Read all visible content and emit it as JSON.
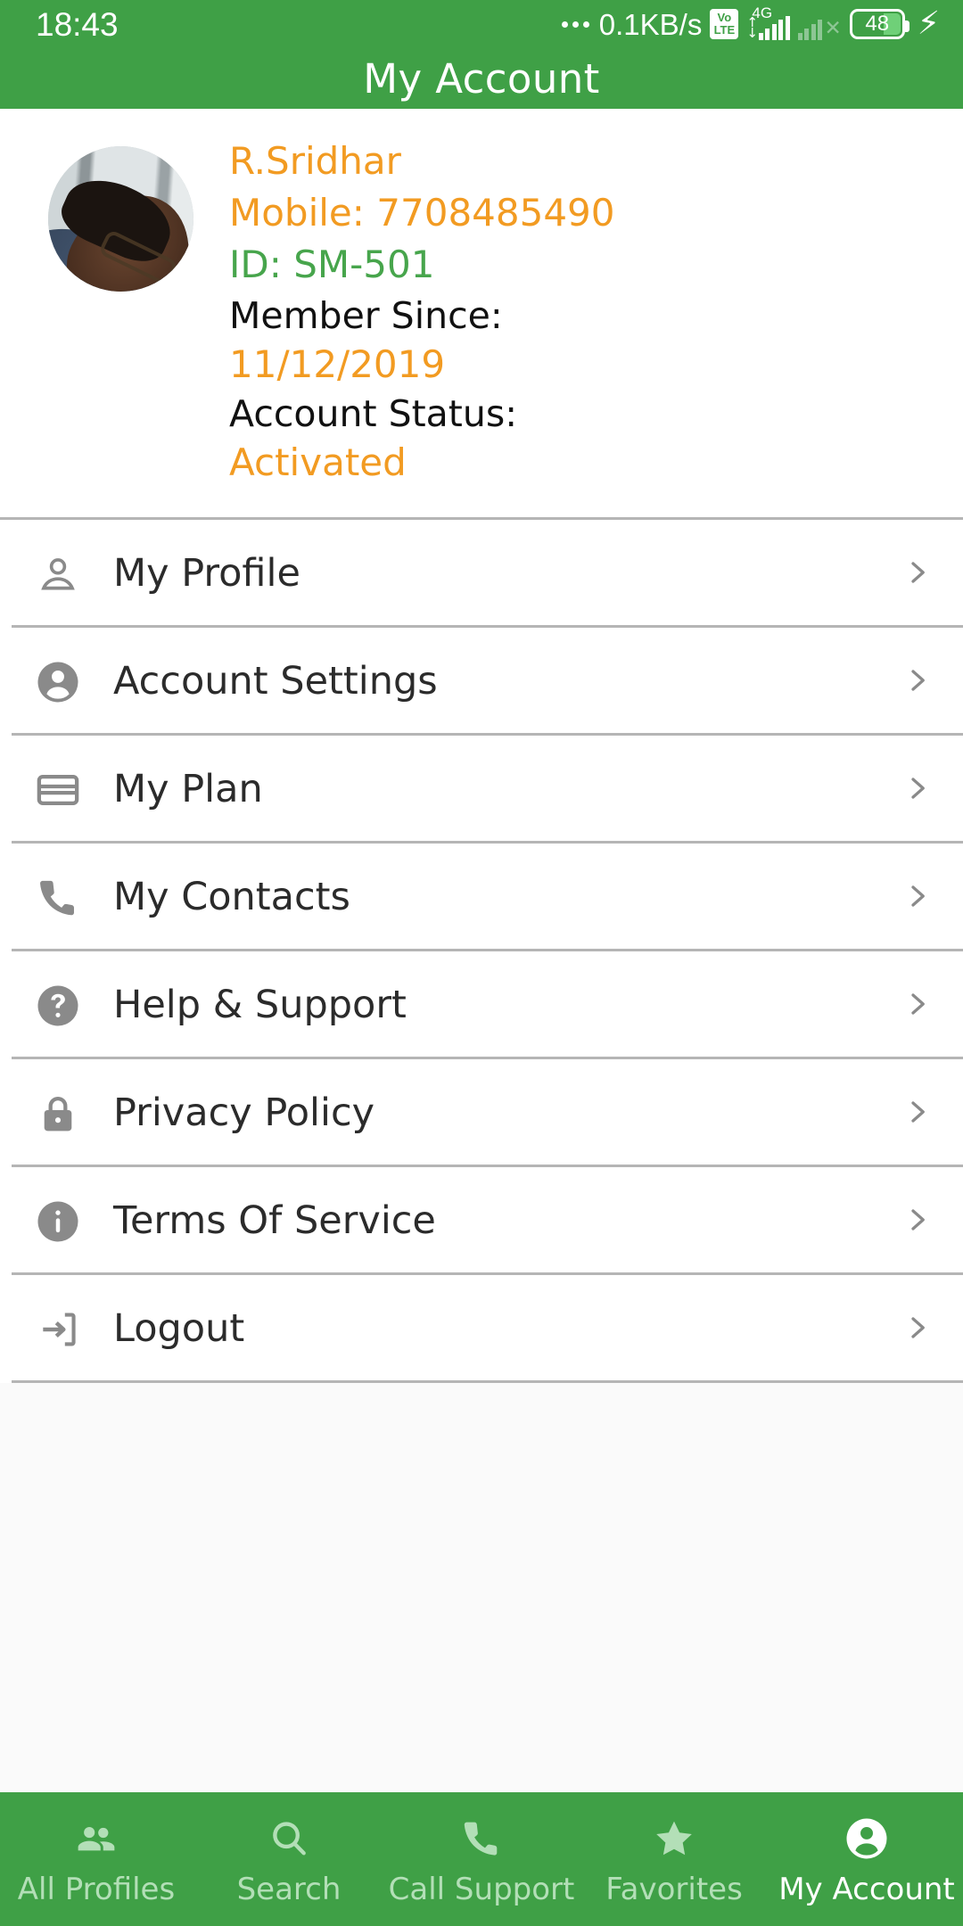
{
  "colors": {
    "brand_green": "#3fa046",
    "accent_orange": "#f29b22",
    "id_green": "#47a54c",
    "divider_gray": "#b5b5b5",
    "icon_gray": "#8a8a8a",
    "nav_inactive": "#b3dfb7",
    "nav_active": "#ffffff",
    "page_bg": "#fafafa"
  },
  "statusbar": {
    "clock": "18:43",
    "network_speed": "0.1KB/s",
    "volte_top": "Vo",
    "volte_bottom": "LTE",
    "signal_generation": "4G",
    "battery_level": "48",
    "charging_glyph": "⚡",
    "icons": [
      "more-dots-icon",
      "volte-icon",
      "signal-bars-icon",
      "signal-bars-no-service-icon",
      "battery-icon",
      "charging-bolt-icon"
    ]
  },
  "appbar": {
    "title": "My Account"
  },
  "profile": {
    "avatar_name": "avatar",
    "name": "R.Sridhar",
    "mobile": "Mobile: 7708485490",
    "id": "ID: SM-501",
    "member_since_label": "Member Since:",
    "member_since_value": "11/12/2019",
    "account_status_label": "Account Status:",
    "account_status_value": "Activated"
  },
  "menu": {
    "items": [
      {
        "label": "My Profile",
        "icon": "person-outline-icon",
        "chevron": "chevron-right-icon"
      },
      {
        "label": "Account Settings",
        "icon": "account-circle-icon",
        "chevron": "chevron-right-icon"
      },
      {
        "label": "My Plan",
        "icon": "credit-card-icon",
        "chevron": "chevron-right-icon"
      },
      {
        "label": "My Contacts",
        "icon": "phone-icon",
        "chevron": "chevron-right-icon"
      },
      {
        "label": "Help & Support",
        "icon": "help-circle-icon",
        "chevron": "chevron-right-icon"
      },
      {
        "label": "Privacy Policy",
        "icon": "lock-icon",
        "chevron": "chevron-right-icon"
      },
      {
        "label": "Terms Of Service",
        "icon": "info-circle-icon",
        "chevron": "chevron-right-icon"
      },
      {
        "label": "Logout",
        "icon": "logout-icon",
        "chevron": "chevron-right-icon"
      }
    ]
  },
  "bottomnav": {
    "items": [
      {
        "label": "All Profiles",
        "icon": "people-icon",
        "active": false
      },
      {
        "label": "Search",
        "icon": "search-icon",
        "active": false
      },
      {
        "label": "Call Support",
        "icon": "phone-icon",
        "active": false
      },
      {
        "label": "Favorites",
        "icon": "star-icon",
        "active": false
      },
      {
        "label": "My Account",
        "icon": "account-circle-icon",
        "active": true
      }
    ]
  }
}
